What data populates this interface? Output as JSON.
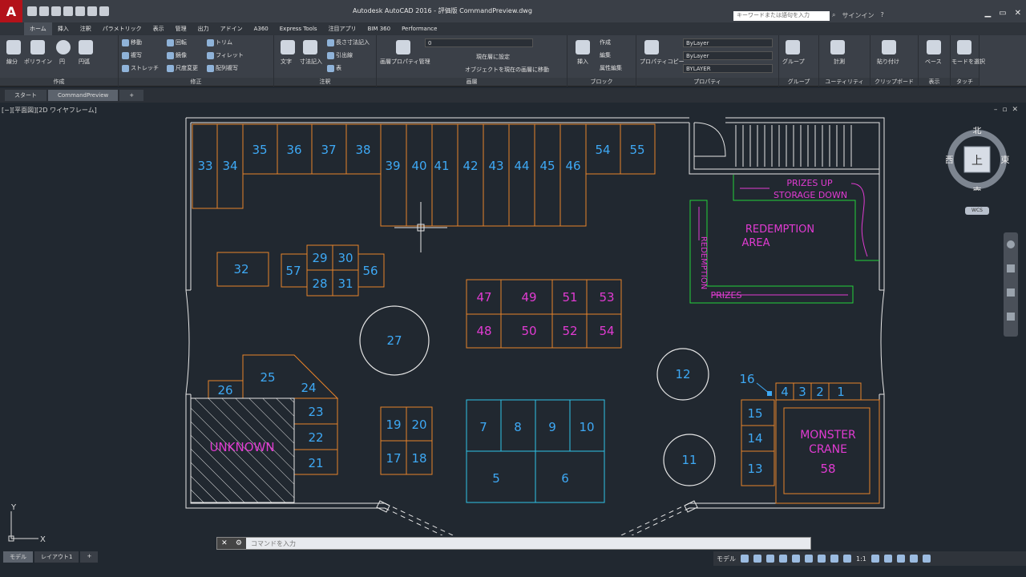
{
  "app": {
    "title": "Autodesk AutoCAD 2016 - 評価版   CommandPreview.dwg",
    "search_placeholder": "キーワードまたは語句を入力",
    "user": "サインイン"
  },
  "ribbon_tabs": [
    "ホーム",
    "挿入",
    "注釈",
    "パラメトリック",
    "表示",
    "管理",
    "出力",
    "アドイン",
    "A360",
    "Express Tools",
    "注目アプリ",
    "BIM 360",
    "Performance"
  ],
  "panels": {
    "draw": {
      "label": "作成",
      "line": "線分",
      "polyline": "ポリライン",
      "circle": "円",
      "arc": "円弧"
    },
    "modify": {
      "label": "修正",
      "move": "移動",
      "rotate": "回転",
      "trim": "トリム",
      "copy": "複写",
      "mirror": "鏡像",
      "fillet": "フィレット",
      "stretch": "ストレッチ",
      "scale": "尺度変更",
      "array": "配列複写"
    },
    "annotation": {
      "label": "注釈",
      "text": "文字",
      "dimension": "寸法記入",
      "leader": "引出線",
      "table": "表",
      "linear": "長さ寸法記入"
    },
    "layers": {
      "label": "画層",
      "props": "画層プロパティ管理",
      "layer_name": "0",
      "make_current": "現在層に設定",
      "match": "オブジェクトを現在の画層に移動"
    },
    "block": {
      "label": "ブロック",
      "insert": "挿入",
      "create": "作成",
      "edit": "編集",
      "attr": "属性編集"
    },
    "properties": {
      "label": "プロパティ",
      "match": "プロパティコピー",
      "color": "ByLayer",
      "linetype": "ByLayer",
      "lineweight": "BYLAYER"
    },
    "groups": {
      "label": "グループ",
      "group": "グループ"
    },
    "utilities": {
      "label": "ユーティリティ",
      "measure": "計測"
    },
    "clipboard": {
      "label": "クリップボード",
      "paste": "貼り付け"
    },
    "view": {
      "label": "表示",
      "base": "ベース"
    },
    "touch": {
      "label": "タッチ",
      "select_mode": "モードを選択"
    }
  },
  "doc_tabs": [
    "スタート",
    "CommandPreview"
  ],
  "viewport_label": "[−][平面図][2D ワイヤフレーム]",
  "viewcube": {
    "north": "北",
    "south": "南",
    "east": "東",
    "west": "西",
    "top": "上",
    "wcs": "WCS"
  },
  "command_line": {
    "placeholder": "コマンドを入力"
  },
  "model_tabs": [
    "モデル",
    "レイアウト1"
  ],
  "status": {
    "model": "モデル",
    "scale": "1:1"
  },
  "colors": {
    "orange": "#e8832a",
    "blue": "#3ea9f5",
    "magenta": "#e13bd2",
    "cyan": "#2ec4e8",
    "green": "#23d23a",
    "white": "#e6e6e6"
  },
  "drawing": {
    "booths_top": [
      "33",
      "34",
      "35",
      "36",
      "37",
      "38",
      "39",
      "40",
      "41",
      "42",
      "43",
      "44",
      "45",
      "46",
      "54",
      "55"
    ],
    "booths_mid": [
      "32",
      "57",
      "29",
      "30",
      "28",
      "31",
      "56"
    ],
    "booths_grid_magenta": [
      "47",
      "49",
      "51",
      "53",
      "48",
      "50",
      "52",
      "54"
    ],
    "circles": [
      "27",
      "12",
      "11"
    ],
    "booths_left": [
      "26",
      "25",
      "24",
      "23",
      "22",
      "21"
    ],
    "unknown": "UNKNOWN",
    "booths_center_small": [
      "19",
      "20",
      "17",
      "18"
    ],
    "booths_cyan": [
      "7",
      "8",
      "9",
      "10",
      "5",
      "6"
    ],
    "booths_right_col": [
      "15",
      "14",
      "13"
    ],
    "booths_right_top": [
      "16",
      "4",
      "3",
      "2",
      "1"
    ],
    "monster": [
      "MONSTER",
      "CRANE",
      "58"
    ],
    "redemption": {
      "prizes_storage_1": "PRIZES UP",
      "prizes_storage_2": "STORAGE DOWN",
      "area_1": "REDEMPTION",
      "area_2": "AREA",
      "vertical": "REDEMPTION",
      "prizes": "PRIZES"
    }
  }
}
